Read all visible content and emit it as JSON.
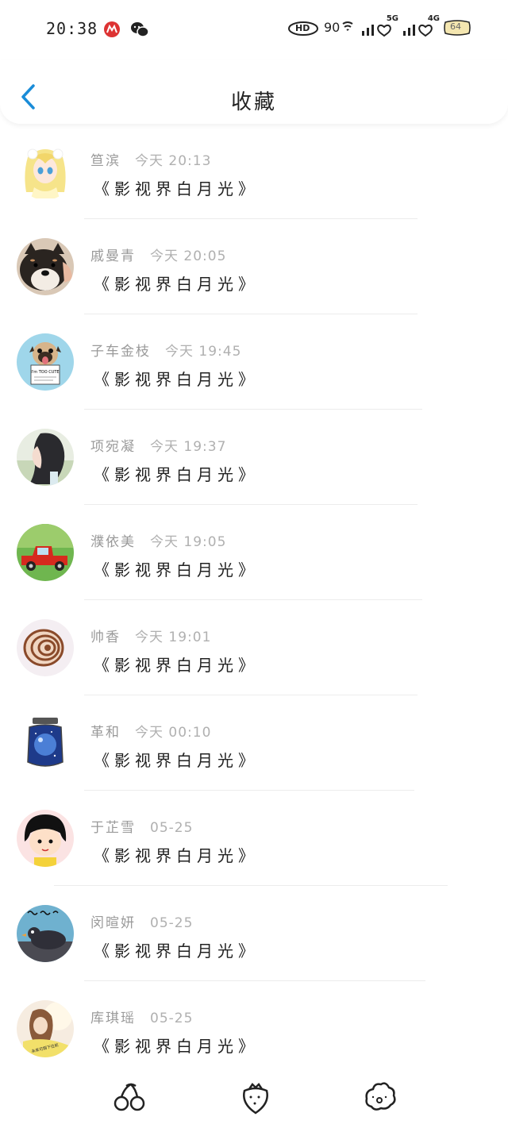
{
  "status_bar": {
    "time": "20:38",
    "apps": [
      "metro-app-icon",
      "wechat-icon"
    ],
    "indicators": [
      "hd-icon",
      "wifi-icon",
      "signal-5g-icon",
      "signal-4g-icon",
      "battery-icon"
    ],
    "signal_1_label": "5G",
    "signal_2_label": "4G",
    "battery_level": "64",
    "hd_label": "HD"
  },
  "header": {
    "title": "收藏"
  },
  "favorites": [
    {
      "name": "笪滨",
      "time": "今天 20:13",
      "content": "《影视界白月光》",
      "avatar": "anime-girl"
    },
    {
      "name": "戚曼青",
      "time": "今天 20:05",
      "content": "《影视界白月光》",
      "avatar": "shiba-dog"
    },
    {
      "name": "子车金枝",
      "time": "今天 19:45",
      "content": "《影视界白月光》",
      "avatar": "pug-sign"
    },
    {
      "name": "项宛凝",
      "time": "今天 19:37",
      "content": "《影视界白月光》",
      "avatar": "girl-profile"
    },
    {
      "name": "濮依美",
      "time": "今天 19:05",
      "content": "《影视界白月光》",
      "avatar": "red-truck"
    },
    {
      "name": "帅香",
      "time": "今天 19:01",
      "content": "《影视界白月光》",
      "avatar": "shell"
    },
    {
      "name": "革和",
      "time": "今天 00:10",
      "content": "《影视界白月光》",
      "avatar": "jar-galaxy"
    },
    {
      "name": "于芷雪",
      "time": "05-25",
      "content": "《影视界白月光》",
      "avatar": "cartoon-girl"
    },
    {
      "name": "闵暄妍",
      "time": "05-25",
      "content": "《影视界白月光》",
      "avatar": "bird-doodle"
    },
    {
      "name": "库琪瑶",
      "time": "05-25",
      "content": "《影视界白月光》",
      "avatar": "girl-sunlight"
    }
  ],
  "avatar_text": {
    "pug_sign": "I'm TOO CUTE",
    "sunlight_girl": "未来可期下往前"
  },
  "bottom_nav": [
    {
      "icon": "cherry-icon"
    },
    {
      "icon": "strawberry-icon"
    },
    {
      "icon": "cookie-face-icon"
    }
  ],
  "colors": {
    "accent": "#1a8cd8",
    "name_text": "#9a9a9a",
    "content_text": "#222222",
    "divider": "#ececec"
  }
}
